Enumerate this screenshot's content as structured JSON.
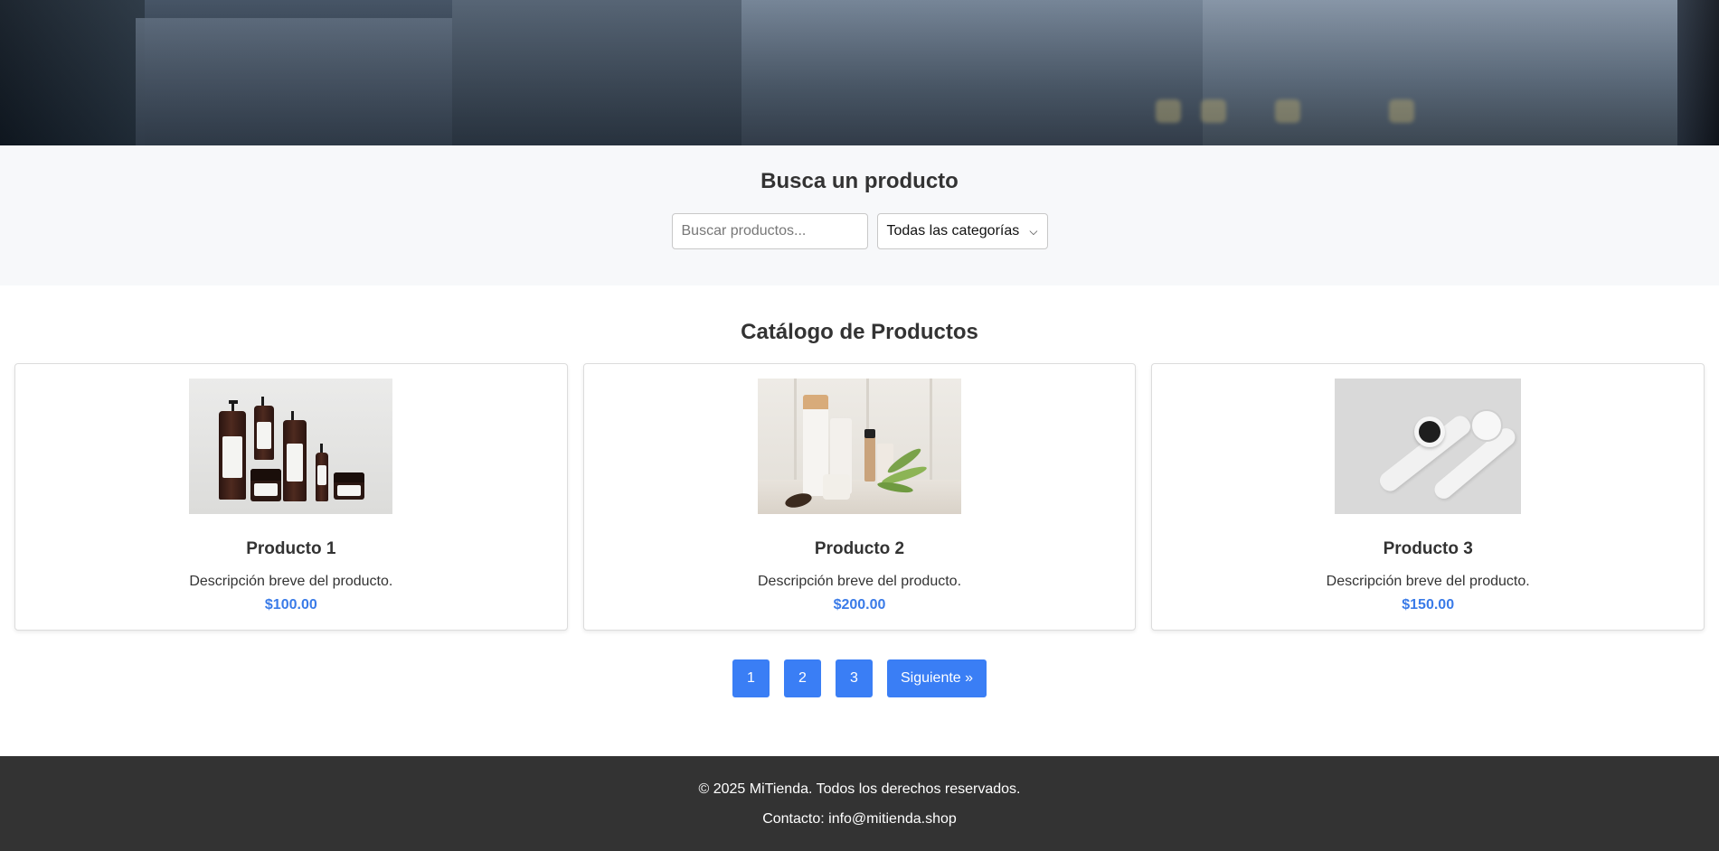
{
  "search": {
    "title": "Busca un producto",
    "placeholder": "Buscar productos...",
    "category_selected": "Todas las categorías"
  },
  "catalog": {
    "title": "Catálogo de Productos",
    "products": [
      {
        "name": "Producto 1",
        "description": "Descripción breve del producto.",
        "price": "$100.00"
      },
      {
        "name": "Producto 2",
        "description": "Descripción breve del producto.",
        "price": "$200.00"
      },
      {
        "name": "Producto 3",
        "description": "Descripción breve del producto.",
        "price": "$150.00"
      }
    ]
  },
  "pagination": {
    "pages": [
      "1",
      "2",
      "3"
    ],
    "next_label": "Siguiente »"
  },
  "footer": {
    "copyright": "© 2025 MiTienda. Todos los derechos reservados.",
    "contact": "Contacto: info@mitienda.shop"
  },
  "colors": {
    "accent": "#3a7ef5",
    "price": "#3a7be8",
    "footer_bg": "#333333",
    "search_bg": "#f7f8fa"
  }
}
